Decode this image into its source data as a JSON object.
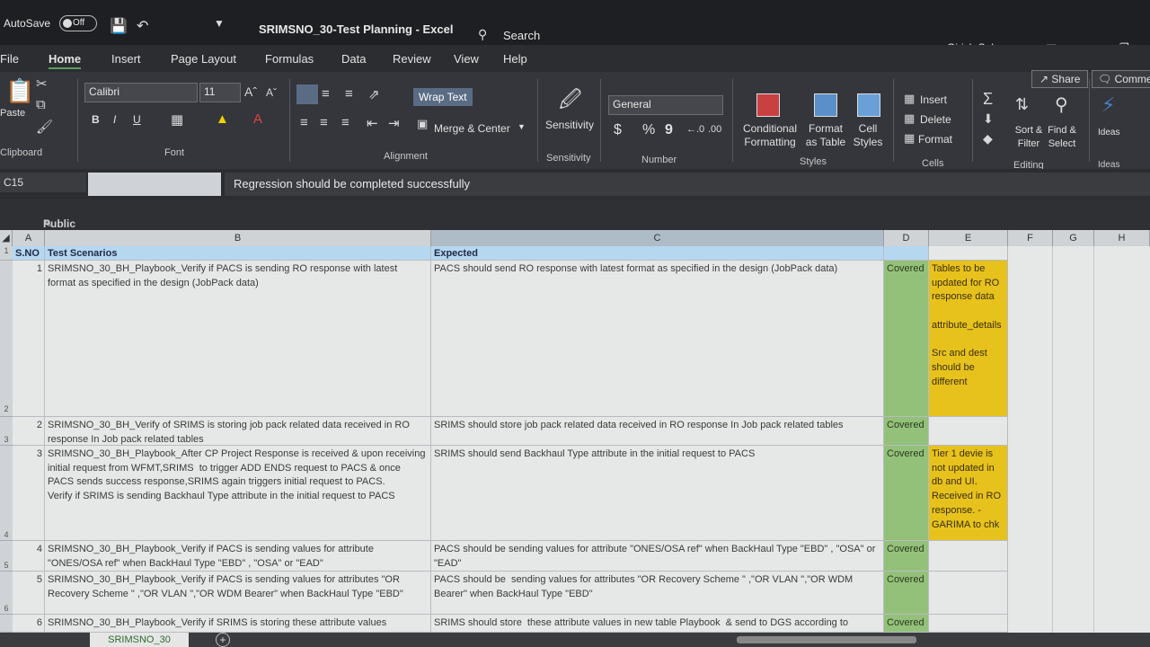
{
  "titlebar": {
    "autosave": "AutoSave",
    "toggle": "Off",
    "doc_title": "SRIMSNO_30-Test Planning  -  Excel",
    "search": "Search",
    "user": "Girish Sekar"
  },
  "tabs": [
    "File",
    "Home",
    "Insert",
    "Page Layout",
    "Formulas",
    "Data",
    "Review",
    "View",
    "Help"
  ],
  "ribbon": {
    "clipboard": {
      "paste": "Paste",
      "label": "Clipboard"
    },
    "font": {
      "name": "Calibri",
      "size": "11",
      "label": "Font",
      "bold": "B",
      "italic": "I",
      "underline": "U"
    },
    "alignment": {
      "wrap_text": "Wrap Text",
      "merge_center": "Merge & Center",
      "label": "Alignment"
    },
    "sensitivity": {
      "button": "Sensitivity",
      "label": "Sensitivity"
    },
    "number": {
      "format": "General",
      "currency": "$",
      "percent": "%",
      "comma": "9",
      "label": "Number"
    },
    "styles": {
      "conditional": "Conditional Formatting",
      "format_table": "Format as Table",
      "cell_styles": "Cell Styles",
      "label": "Styles"
    },
    "cells": {
      "insert": "Insert",
      "delete": "Delete",
      "format": "Format",
      "label": "Cells"
    },
    "editing": {
      "sort_filter": "Sort & Filter",
      "find_select": "Find & Select",
      "label": "Editing"
    },
    "ideas": {
      "button": "Ideas",
      "label": "Ideas"
    },
    "share": "Share",
    "comments": "Comments"
  },
  "formula_bar": {
    "name_box": "C15",
    "content": "Regression should be completed successfully"
  },
  "sensitivity_label": "Public",
  "columns": [
    "A",
    "B",
    "C",
    "D",
    "E",
    "F",
    "G",
    "H"
  ],
  "row_numbers": [
    "1",
    "2",
    "3",
    "4",
    "5",
    "6"
  ],
  "header_row": {
    "a": "S.NO",
    "b": "Test Scenarios",
    "c": "Expected"
  },
  "rows": [
    {
      "sno": "1",
      "scenario": "SRIMSNO_30_BH_Playbook_Verify if PACS is sending RO response with latest format as specified in the design (JobPack data)",
      "expected": "PACS should send RO response with latest format as specified in the design (JobPack data)",
      "status": "Covered",
      "notes": "Tables to be updated for RO response data\n\nattribute_details\n\nSrc and dest should be different"
    },
    {
      "sno": "2",
      "scenario": "SRIMSNO_30_BH_Verify of SRIMS is storing job pack related data received in RO response In Job pack related tables",
      "expected": "SRIMS should store job pack related data received in RO response In Job pack related tables",
      "status": "Covered",
      "notes": ""
    },
    {
      "sno": "3",
      "scenario": "SRIMSNO_30_BH_Playbook_After CP Project Response is received & upon receiving initial request from WFMT,SRIMS  to trigger ADD ENDS request to PACS & once PACS sends success response,SRIMS again triggers initial request to PACS.\nVerify if SRIMS is sending Backhaul Type attribute in the initial request to PACS",
      "expected": "SRIMS should send Backhaul Type attribute in the initial request to PACS",
      "status": "Covered",
      "notes": "Tier 1 devie is not updated in db and UI. Received in RO response. - GARIMA to chk"
    },
    {
      "sno": "4",
      "scenario": "SRIMSNO_30_BH_Playbook_Verify if PACS is sending values for attribute \"ONES/OSA ref\" when BackHaul Type \"EBD\" , \"OSA\" or \"EAD\"",
      "expected": "PACS should be sending values for attribute \"ONES/OSA ref\" when BackHaul Type \"EBD\" , \"OSA\" or \"EAD\"",
      "status": "Covered",
      "notes": ""
    },
    {
      "sno": "5",
      "scenario": "SRIMSNO_30_BH_Playbook_Verify if PACS is sending values for attributes \"OR Recovery Scheme \" ,\"OR VLAN \",\"OR WDM Bearer\" when BackHaul Type \"EBD\"",
      "expected": "PACS should be  sending values for attributes \"OR Recovery Scheme \" ,\"OR VLAN \",\"OR WDM Bearer\" when BackHaul Type \"EBD\"",
      "status": "Covered",
      "notes": ""
    },
    {
      "sno": "6",
      "scenario": "SRIMSNO_30_BH_Playbook_Verify if SRIMS is storing these attribute values",
      "expected": "SRIMS should store  these attribute values in new table Playbook  & send to DGS according to",
      "status": "Covered",
      "notes": ""
    }
  ],
  "sheet_tab": "SRIMSNO_30",
  "colors": {
    "covered_green": "#93c17a",
    "note_yellow": "#e7c21c",
    "header_blue": "#b6d7f0"
  }
}
